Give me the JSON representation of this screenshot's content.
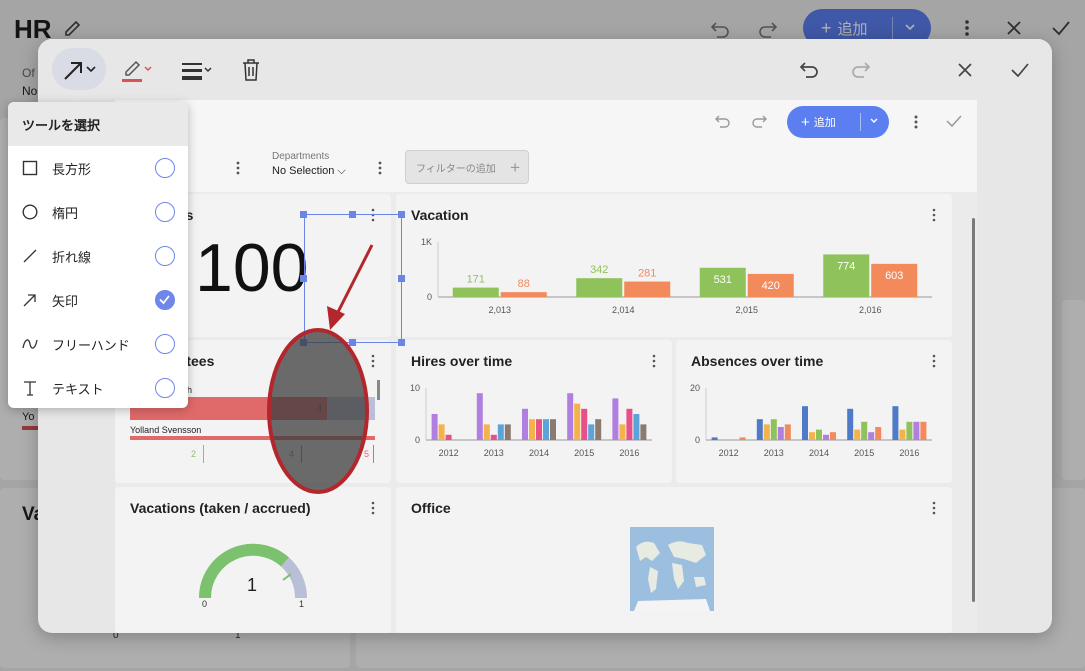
{
  "background_app": {
    "title": "HR",
    "add_label": "追加",
    "office_label_fragment": "Of",
    "office_value_fragment": "No",
    "vacations_fragment": "Va",
    "yolland_fragment": "Yo",
    "axis_zero": "0",
    "axis_one": "1"
  },
  "annotation_toolbar": {
    "tools": [
      "arrow-tool",
      "pen-color-tool",
      "line-weight-tool",
      "delete-tool"
    ],
    "pen_color": "#d9534f"
  },
  "tool_popup": {
    "title": "ツールを選択",
    "items": [
      {
        "label": "長方形",
        "icon": "rectangle-icon",
        "selected": false
      },
      {
        "label": "楕円",
        "icon": "ellipse-icon",
        "selected": false
      },
      {
        "label": "折れ線",
        "icon": "polyline-icon",
        "selected": false
      },
      {
        "label": "矢印",
        "icon": "arrow-icon",
        "selected": true
      },
      {
        "label": "フリーハンド",
        "icon": "freehand-icon",
        "selected": false
      },
      {
        "label": "テキスト",
        "icon": "text-icon",
        "selected": false
      }
    ]
  },
  "screenshot": {
    "add_label": "追加",
    "filter1_value_fragment": "n",
    "departments_label": "Departments",
    "departments_value": "No Selection",
    "add_filter_placeholder": "フィルターの追加",
    "cards": {
      "employees": {
        "title_fragment": "ees",
        "value_fragment": "100"
      },
      "vacation": {
        "title": "Vacation"
      },
      "absentees": {
        "title_fragment": "entees",
        "row1_label_fragment": "h",
        "row2_label": "Yolland Svensson",
        "row1_value": "4",
        "tick_values": [
          "2",
          "4",
          "5"
        ]
      },
      "hires": {
        "title": "Hires over time"
      },
      "absences": {
        "title": "Absences over time"
      },
      "vac_taken": {
        "title": "Vacations (taken / accrued)",
        "gauge_value": "1",
        "gauge_min": "0",
        "gauge_max": "1"
      },
      "office": {
        "title": "Office"
      }
    }
  },
  "chart_data": [
    {
      "type": "bar",
      "title": "Vacation",
      "categories": [
        "2,013",
        "2,014",
        "2,015",
        "2,016"
      ],
      "ylim": [
        0,
        1000
      ],
      "yticks": [
        "0",
        "1K"
      ],
      "series": [
        {
          "color": "#8fc25a",
          "values": [
            171,
            342,
            531,
            774
          ]
        },
        {
          "color": "#f28a5c",
          "values": [
            88,
            281,
            420,
            603
          ]
        }
      ]
    },
    {
      "type": "bar",
      "title": "Hires over time",
      "categories": [
        "2012",
        "2013",
        "2014",
        "2015",
        "2016"
      ],
      "ylim": [
        0,
        10
      ],
      "yticks": [
        "0",
        "10"
      ],
      "series": [
        {
          "color": "#b07fe0",
          "values": [
            5,
            9,
            6,
            9,
            8
          ]
        },
        {
          "color": "#f5b24a",
          "values": [
            3,
            3,
            4,
            7,
            3
          ]
        },
        {
          "color": "#e8508a",
          "values": [
            1,
            1,
            4,
            6,
            6
          ]
        },
        {
          "color": "#5ba3d9",
          "values": [
            0,
            3,
            4,
            3,
            5
          ]
        },
        {
          "color": "#8a7a70",
          "values": [
            0,
            3,
            4,
            4,
            3
          ]
        }
      ]
    },
    {
      "type": "bar",
      "title": "Absences over time",
      "categories": [
        "2012",
        "2013",
        "2014",
        "2015",
        "2016"
      ],
      "ylim": [
        0,
        20
      ],
      "yticks": [
        "0",
        "20"
      ],
      "series": [
        {
          "color": "#4e7ac7",
          "values": [
            1,
            8,
            13,
            12,
            13
          ]
        },
        {
          "color": "#f5b24a",
          "values": [
            0,
            6,
            3,
            4,
            4
          ]
        },
        {
          "color": "#8fc25a",
          "values": [
            0,
            8,
            4,
            7,
            7
          ]
        },
        {
          "color": "#b07fe0",
          "values": [
            0,
            5,
            2,
            3,
            7
          ]
        },
        {
          "color": "#f28a5c",
          "values": [
            1,
            6,
            3,
            5,
            7
          ]
        }
      ]
    }
  ]
}
